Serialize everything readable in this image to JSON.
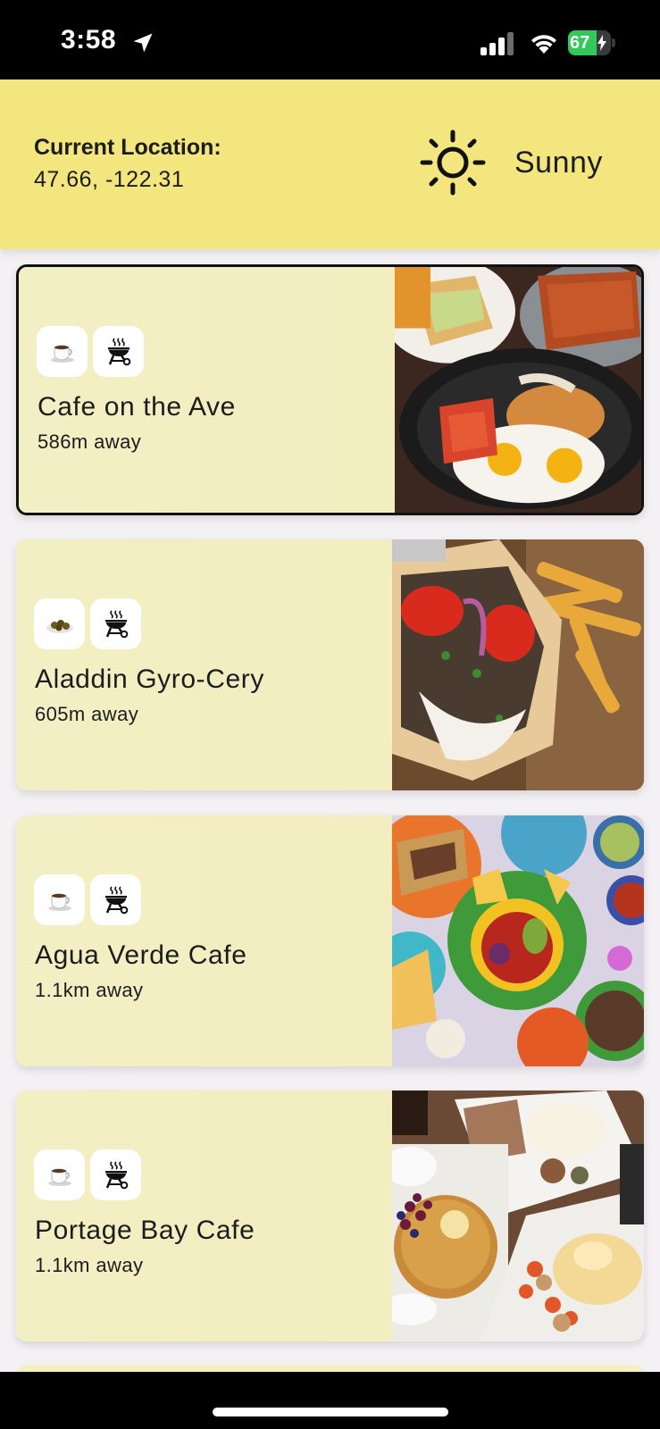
{
  "status_bar": {
    "time": "3:58",
    "battery_percent": "67",
    "battery_level": 0.67,
    "icons": [
      "location-arrow-icon",
      "cellular-signal-icon",
      "wifi-icon",
      "battery-charging-icon"
    ]
  },
  "header": {
    "location_label": "Current Location:",
    "location_value": "47.66, -122.31",
    "weather_icon": "sun-icon",
    "weather_text": "Sunny",
    "background_color": "#f3e67f"
  },
  "restaurants": [
    {
      "name": "Cafe on the Ave",
      "distance": "586m away",
      "badges": [
        "coffee-cup-icon",
        "grill-icon"
      ],
      "selected": true,
      "photo": "breakfast-plates-photo"
    },
    {
      "name": "Aladdin Gyro-Cery",
      "distance": "605m away",
      "badges": [
        "falafel-plate-icon",
        "grill-icon"
      ],
      "selected": false,
      "photo": "gyro-and-fries-photo"
    },
    {
      "name": "Agua Verde Cafe",
      "distance": "1.1km away",
      "badges": [
        "coffee-cup-icon",
        "grill-icon"
      ],
      "selected": false,
      "photo": "mexican-dishes-photo"
    },
    {
      "name": "Portage Bay Cafe",
      "distance": "1.1km away",
      "badges": [
        "coffee-cup-icon",
        "grill-icon"
      ],
      "selected": false,
      "photo": "pancakes-brunch-photo"
    }
  ],
  "colors": {
    "card_background": "#f3efbf",
    "accent_yellow": "#f3e67f",
    "battery_green": "#34c759"
  }
}
